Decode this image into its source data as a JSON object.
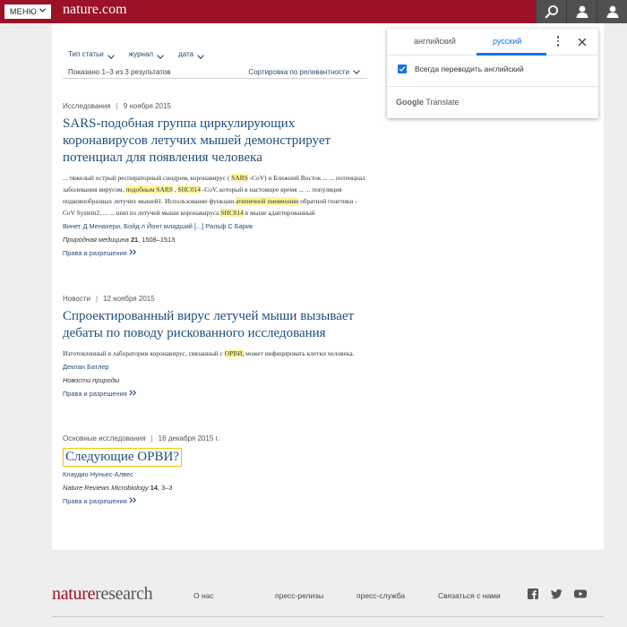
{
  "header": {
    "menu_label": "МЕНЮ",
    "brand": "nature.com",
    "icons": [
      "search-icon",
      "user-icon",
      "user-icon"
    ]
  },
  "filters": {
    "items": [
      "Тип статьи",
      "журнал",
      "дата"
    ],
    "results_count": "Показано 1–3 из 3 результатов",
    "sort_label": "Сортировка по релевантности"
  },
  "articles": [
    {
      "type": "Исследования",
      "date": "9 ноября 2015",
      "title": "SARS-подобная группа циркулирующих коронавирусов летучих мышей демонстрирует потенциал для появления человека",
      "snippet_parts": [
        "... тяжелый острый респираторный синдром, коронавирус ( ",
        "SARS",
        " -CoV) и Ближний Восток ... ... потенциал заболевания вирусом, ",
        "подобным SARS",
        " , ",
        "SHC014",
        " -CoV, который в настоящее время ... ... популяция подковообразных летучих мышей1. Использование функции ",
        "атипичной пневмонии",
        " обратной генетики -CoV System2, ... ... шип из летучей мыши коронавируса ",
        "SHC014",
        " в мыше адаптированный"
      ],
      "authors": [
        "Винет Д Менахери",
        "Бойд л Йонт младший",
        "[...]",
        "Ральф С Барик"
      ],
      "journal": "Природная медицина",
      "volume": "21",
      "pages": ", 1508–1513",
      "rights": "Права и разрешения"
    },
    {
      "type": "Новости",
      "date": "12 ноября 2015",
      "title": "Спроектированный вирус летучей мыши вызывает дебаты по поводу рискованного исследования",
      "snippet_parts": [
        "Изготовленный в лаборатории коронавирус, связанный с ",
        "ОРВИ,",
        " может инфицировать клетки человека."
      ],
      "authors": [
        "Деклан Батлер"
      ],
      "journal": "Новости природы",
      "rights": "Права и разрешения"
    },
    {
      "type": "Основные исследования",
      "date": "16 декабря 2015 г.",
      "title": "Следующие ОРВИ?",
      "authors": [
        "Клаудио Нуньес-Алвес"
      ],
      "journal": "Nature Reviews Microbiology",
      "volume": "14",
      "pages": ", 3–3",
      "rights": "Права и разрешения"
    }
  ],
  "translate": {
    "tab_source": "английский",
    "tab_target": "русский",
    "always_translate": "Всегда переводить английский",
    "always_checked": true,
    "brand_google": "Google",
    "brand_translate": "Translate",
    "accent": "#1a73e8"
  },
  "footer": {
    "logo_nature": "nature",
    "logo_research": "research",
    "about": "О нас",
    "links": [
      "пресс-релизы",
      "пресс-служба",
      "Связаться с нами"
    ],
    "social": [
      "facebook-icon",
      "twitter-icon",
      "youtube-icon"
    ]
  },
  "colors": {
    "brand_red": "#9b1128",
    "link_blue": "#1f4e79",
    "highlight": "#fff79a"
  }
}
